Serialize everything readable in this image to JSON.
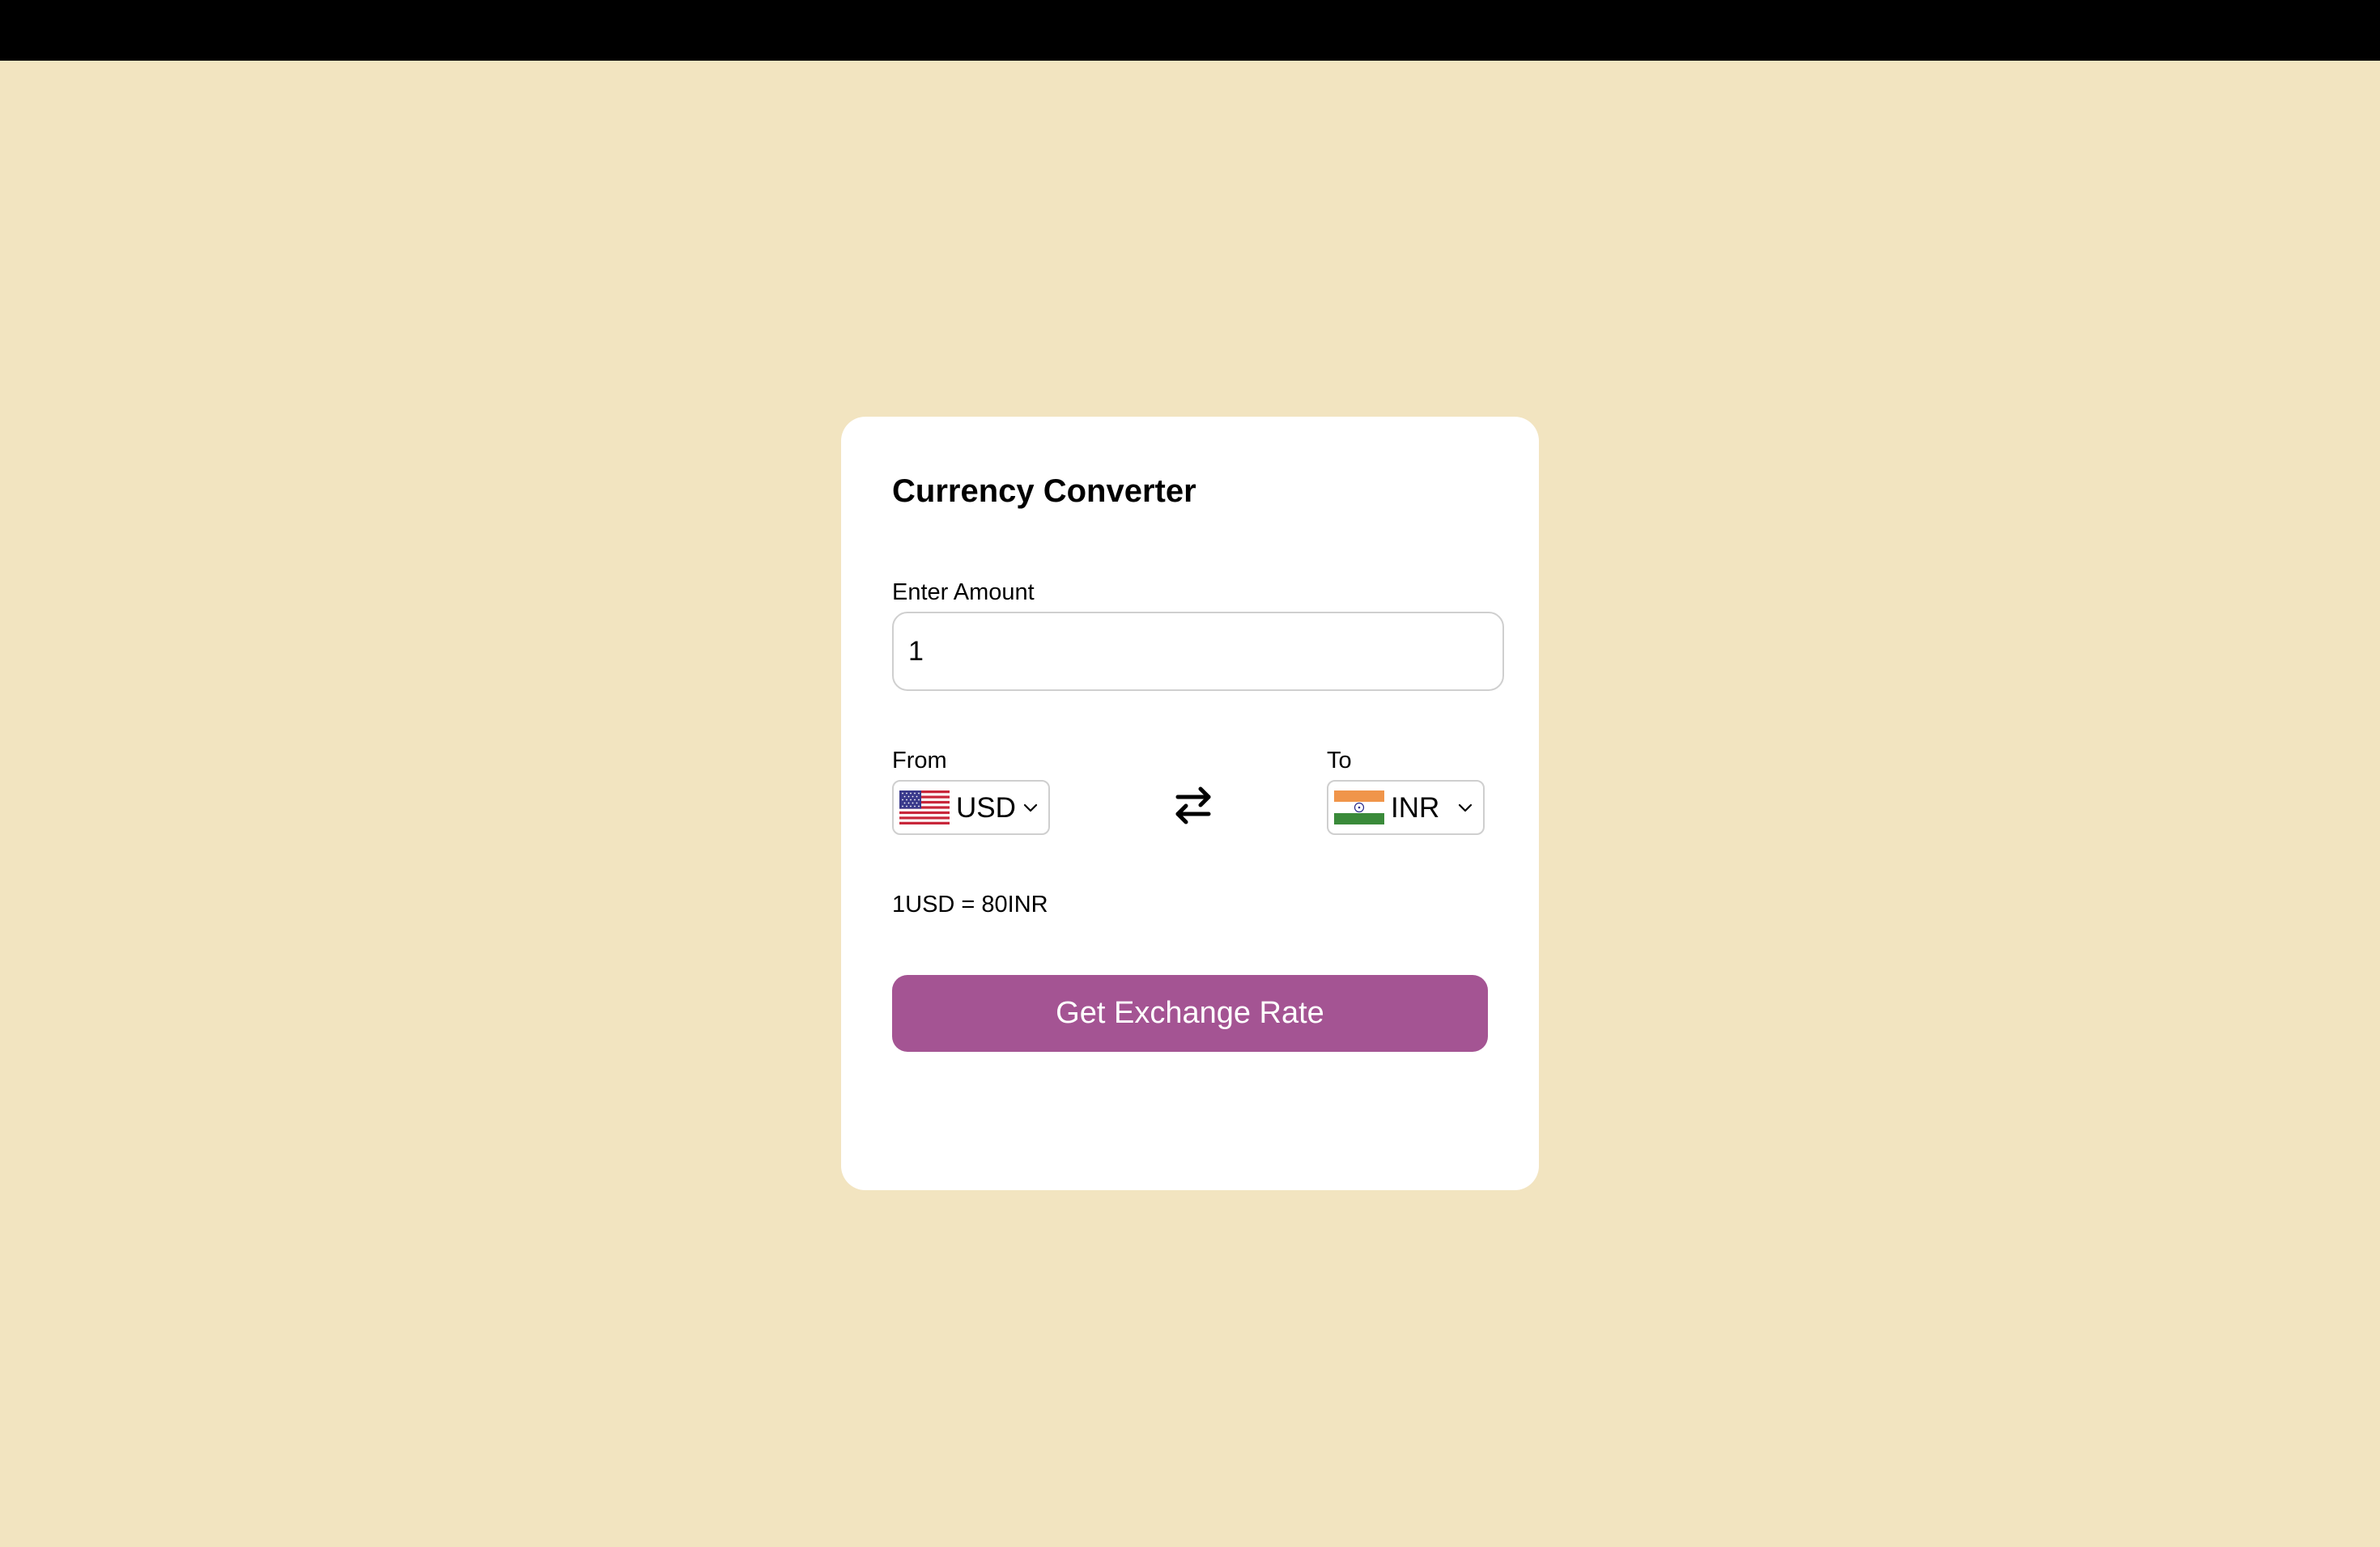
{
  "app": {
    "title": "Currency Converter"
  },
  "amount": {
    "label": "Enter Amount",
    "value": "1"
  },
  "from": {
    "label": "From",
    "currency": "USD",
    "flag_icon": "us-flag-icon"
  },
  "to": {
    "label": "To",
    "currency": "INR",
    "flag_icon": "india-flag-icon"
  },
  "swap_icon": "swap-arrows-icon",
  "result": {
    "text": "1USD = 80INR"
  },
  "actions": {
    "submit_label": "Get Exchange Rate"
  },
  "colors": {
    "background": "#f2e4c0",
    "card": "#ffffff",
    "button": "#a45493",
    "button_text": "#ffffff",
    "top_bar": "#000000"
  }
}
